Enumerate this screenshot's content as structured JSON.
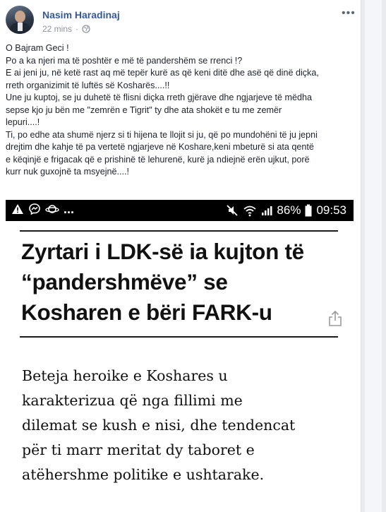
{
  "post": {
    "author": "Nasim Haradinaj",
    "time": "22 mins",
    "separator": "·",
    "privacy_icon": "globe-icon",
    "more_icon": "more-options-icon",
    "more_symbol": "•••",
    "text_lines": [
      "O Bajram Geci !",
      "Po a ka njeri ma të poshtër e më të pandershëm se rrenci !?",
      "E ai jeni ju, në ketë rast aq më tepër kurë as që keni ditë dhe asë që dinë diçka,",
      "rreth organizimit të luftës së Kosharës....!!",
      "Une ju kuptoj, se ju duhetë të flisni diçka rreth gjërave dhe ngjarjeve të mëdha",
      "sepse kjo ju bën me \"zemrën e Tigrit\" ty dhe ata shokët e tu me zemër",
      "lepuri....!",
      "Ti, po edhe ata shumë njerz si ti hijena te llojit si ju, që po mundohëni të ju jepni",
      "drejtim dhe kahje të pa vertetë ngjarjeve në Koshare,keni mbeturë si ata qentë",
      "e këqinjë e frigacak që e prishinë të lehurenë, kurë ja ndiejnë erën ujkut, porë",
      "kurr nuk guxojnë ta msyejnë....!"
    ]
  },
  "screenshot": {
    "status_bar": {
      "left_icons": [
        "warning-icon",
        "messenger-icon",
        "saturn-icon"
      ],
      "left_more": "...",
      "right_icons": [
        "mute-icon",
        "wifi-icon",
        "signal-icon"
      ],
      "battery": "86%",
      "time": "09:53"
    },
    "headline_lines": [
      "Zyrtari i LDK-së ia kujton të",
      "“pandershmëve” se",
      "Kosharen e bëri FARK-u"
    ],
    "lead_lines": [
      "Beteja heroike e Koshares u",
      "karakterizua që nga fillimi me",
      "dilemat se kush e nisi, dhe tendencat",
      "për ti marr meritat dy taboret e",
      "atëhershme politike e ushtarake."
    ]
  },
  "colors": {
    "author_link": "#365899",
    "meta_gray": "#90949c",
    "text": "#1d2129",
    "page_bg": "#e9ebee"
  }
}
